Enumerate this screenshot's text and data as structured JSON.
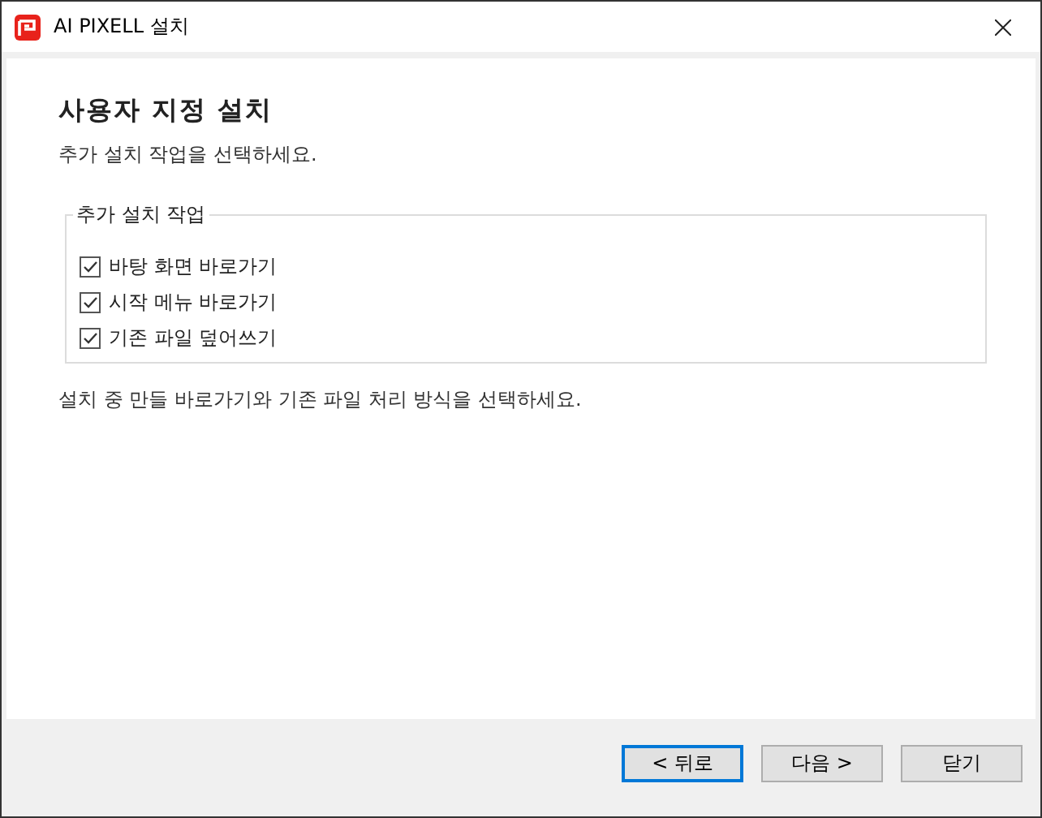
{
  "window": {
    "title": "AI PIXELL 설치"
  },
  "page": {
    "heading": "사용자 지정 설치",
    "subtitle": "추가 설치 작업을 선택하세요."
  },
  "group": {
    "label": "추가 설치 작업",
    "options": [
      {
        "label": "바탕 화면 바로가기",
        "checked": true
      },
      {
        "label": "시작 메뉴 바로가기",
        "checked": true
      },
      {
        "label": "기존 파일 덮어쓰기",
        "checked": true
      }
    ]
  },
  "note": "설치 중 만들 바로가기와 기존 파일 처리 방식을 선택하세요.",
  "buttons": [
    {
      "label": "< 뒤로",
      "focused": true
    },
    {
      "label": "다음 >",
      "focused": false
    },
    {
      "label": "닫기",
      "focused": false
    }
  ]
}
